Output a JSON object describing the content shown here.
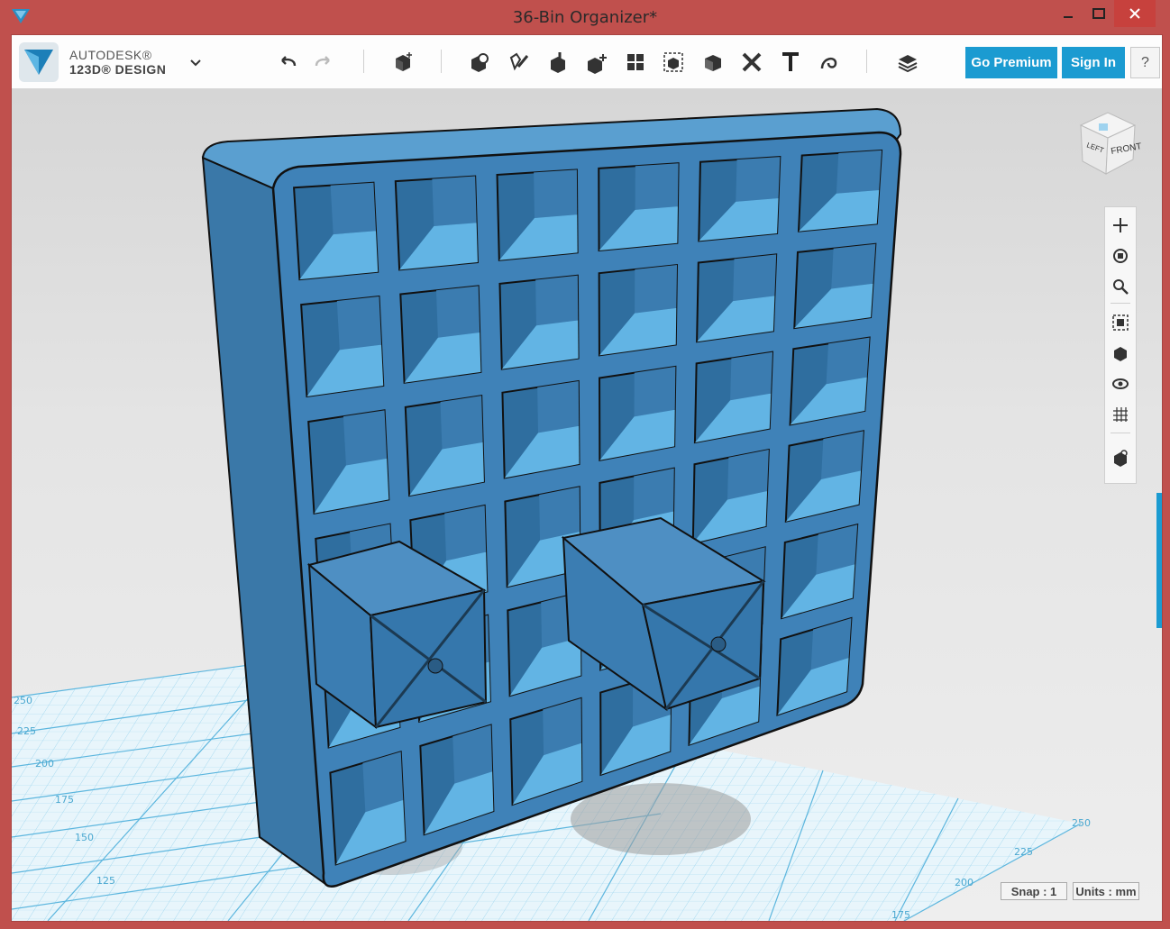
{
  "window": {
    "title": "36-Bin Organizer*"
  },
  "brand": {
    "line1": "AUTODESK®",
    "line2": "123D® DESIGN"
  },
  "toolbar": {
    "tools": [
      "undo-icon",
      "redo-icon",
      "primitives-icon",
      "sketch-icon",
      "construct-icon",
      "modify-icon",
      "pattern-icon",
      "grouping-icon",
      "combine-icon",
      "measure-icon",
      "snap-icon",
      "text-icon",
      "material-icon",
      "layers-icon"
    ],
    "go_premium": "Go Premium",
    "sign_in": "Sign In",
    "help": "?"
  },
  "viewcube": {
    "face_front": "FRONT",
    "face_left": "LEFT"
  },
  "grid": {
    "left_labels": [
      "250",
      "225",
      "200",
      "175",
      "150",
      "125"
    ],
    "bottom_labels": [
      "175",
      "200",
      "225",
      "250"
    ]
  },
  "status": {
    "snap": "Snap : 1",
    "units": "Units : mm"
  },
  "colors": {
    "accent": "#1b9bd1",
    "titlebar": "#c0504d",
    "model": "#3d80b5"
  }
}
